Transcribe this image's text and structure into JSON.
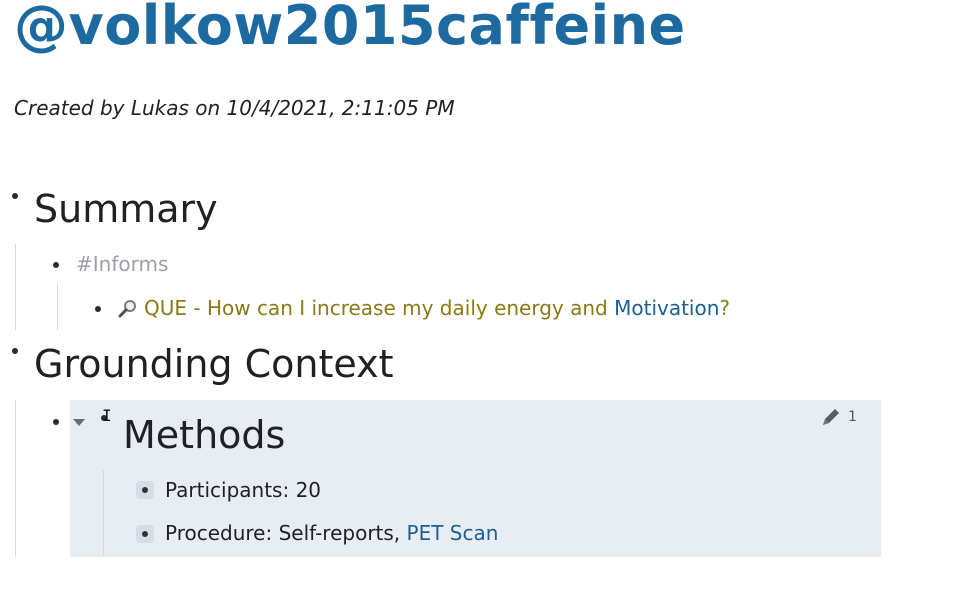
{
  "page": {
    "title": "@volkow2015caffeine",
    "meta": "Created by Lukas on 10/4/2021, 2:11:05 PM"
  },
  "summary": {
    "heading": "Summary",
    "tag": "#Informs",
    "que_prefix": "QUE - How can I increase my daily energy and ",
    "que_link": "Motivation",
    "que_suffix": "?"
  },
  "grounding": {
    "heading": "Grounding Context",
    "methods": {
      "heading": "Methods",
      "edit_count": "1",
      "items": [
        {
          "text": "Participants: 20"
        },
        {
          "text_prefix": "Procedure: Self-reports, ",
          "link": "PET Scan"
        }
      ]
    }
  },
  "colors": {
    "title": "#1d6aa1",
    "que": "#8a7a16",
    "link": "#1d5f91",
    "tag": "#9aa0a6",
    "highlight": "#e8edf4"
  },
  "icons": [
    "magnifier-icon",
    "caret-down-icon",
    "pencil-icon"
  ]
}
